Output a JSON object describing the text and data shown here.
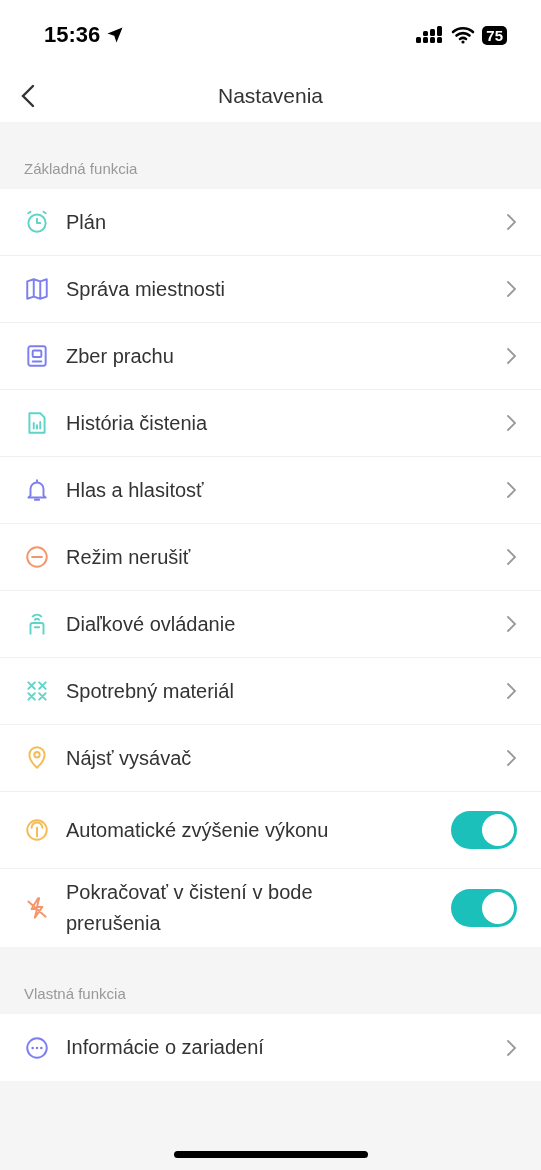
{
  "status_bar": {
    "time": "15:36",
    "battery": "75"
  },
  "nav": {
    "title": "Nastavenia"
  },
  "sections": [
    {
      "header": "Základná funkcia",
      "items": [
        {
          "kind": "link",
          "label": "Plán"
        },
        {
          "kind": "link",
          "label": "Správa miestnosti"
        },
        {
          "kind": "link",
          "label": "Zber prachu"
        },
        {
          "kind": "link",
          "label": "História čistenia"
        },
        {
          "kind": "link",
          "label": "Hlas a hlasitosť"
        },
        {
          "kind": "link",
          "label": "Režim nerušiť"
        },
        {
          "kind": "link",
          "label": "Diaľkové ovládanie"
        },
        {
          "kind": "link",
          "label": "Spotrebný materiál"
        },
        {
          "kind": "link",
          "label": "Nájsť vysávač"
        },
        {
          "kind": "toggle",
          "label": "Automatické zvýšenie výkonu",
          "on": true
        },
        {
          "kind": "toggle",
          "label": "Pokračovať v čistení v bode prerušenia",
          "on": true
        }
      ]
    },
    {
      "header": "Vlastná funkcia",
      "items": [
        {
          "kind": "link",
          "label": "Informácie o zariadení"
        }
      ]
    }
  ]
}
